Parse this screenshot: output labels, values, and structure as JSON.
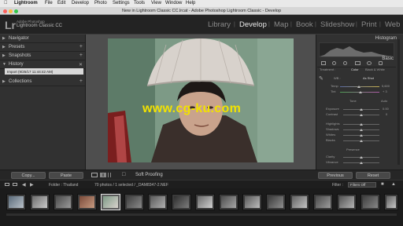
{
  "menubar": {
    "apple": "",
    "app": "Lightroom",
    "items": [
      "File",
      "Edit",
      "Develop",
      "Photo",
      "Settings",
      "Tools",
      "View",
      "Window",
      "Help"
    ]
  },
  "window": {
    "title": "New in Lightroom Classic CC.lrcat - Adobe Photoshop Lightroom Classic - Develop"
  },
  "identity": {
    "logo": "Lr",
    "line1": "Adobe Photoshop",
    "line2": "Lightroom Classic CC"
  },
  "modules": {
    "items": [
      "Library",
      "Develop",
      "Map",
      "Book",
      "Slideshow",
      "Print",
      "Web"
    ],
    "active": "Develop"
  },
  "left_panel": {
    "navigator": "Navigator",
    "presets": "Presets",
    "snapshots": "Snapshots",
    "history": "History",
    "history_item": "Import (9/25/17 11:44:42 AM)",
    "collections": "Collections"
  },
  "right_panel": {
    "histogram": "Histogram",
    "basic": "Basic",
    "treatment_label": "Treatment :",
    "color": "Color",
    "bw": "Black & White",
    "wb_label": "WB :",
    "wb_value": "As Shot",
    "temp": "Temp",
    "temp_value": "5,600",
    "tint": "Tint",
    "tint_value": "+ 3",
    "tone": "Tone",
    "tone_auto": "Auto",
    "exposure": "Exposure",
    "exposure_value": "0.00",
    "contrast": "Contrast",
    "contrast_value": "0",
    "highlights": "Highlights",
    "shadows": "Shadows",
    "whites": "Whites",
    "blacks": "Blacks",
    "presence": "Presence",
    "clarity": "Clarity",
    "vibrance": "Vibrance"
  },
  "toolbar": {
    "copy": "Copy...",
    "paste": "Paste",
    "soft_proofing": "Soft Proofing",
    "previous": "Previous",
    "reset": "Reset"
  },
  "filmstrip_header": {
    "folder": "Folder : Thailand",
    "info": "70 photos / 1 selected / _DAM8347-2.NEF",
    "filter_label": "Filter :",
    "filter_value": "Filters Off"
  },
  "watermark": "www.cg-ku.com",
  "colors": {
    "panel": "#313131",
    "canvas": "#4e4e4e",
    "accent": "#e8e8e8",
    "watermark": "#f2e200"
  }
}
